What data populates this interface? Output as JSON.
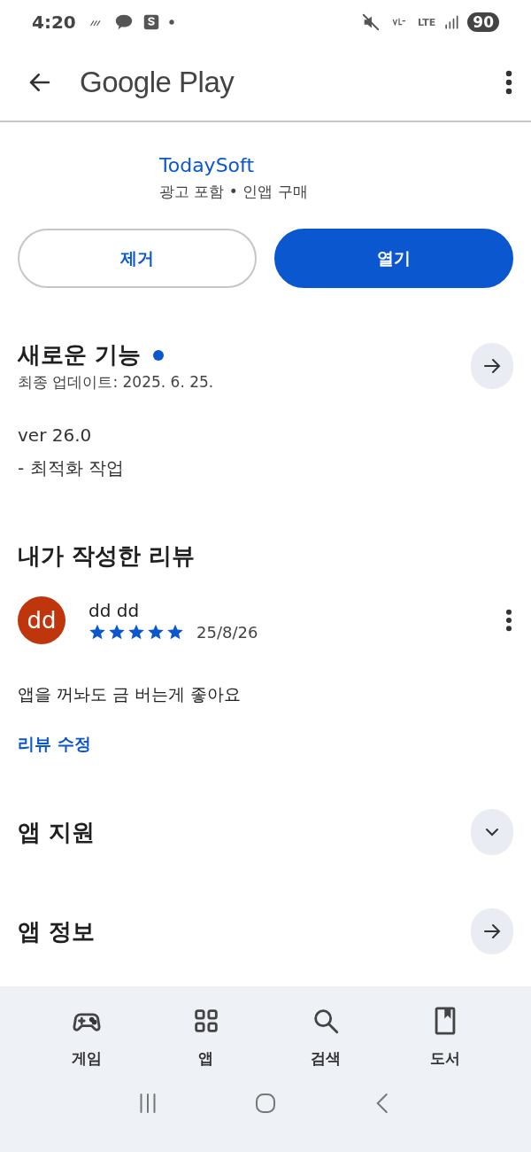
{
  "status_bar": {
    "time": "4:20",
    "battery": "90",
    "network": "LTE"
  },
  "app_bar": {
    "title": "Google Play"
  },
  "app": {
    "developer": "TodaySoft",
    "notes": "광고 포함 • 인앱 구매"
  },
  "buttons": [
    {
      "label": "제거",
      "kind": "outline"
    },
    {
      "label": "열기",
      "kind": "filled"
    }
  ],
  "whats_new": {
    "title": "새로운 기능",
    "new": true,
    "updated": "최종 업데이트: 2025. 6. 25.",
    "lines": [
      "ver 26.0",
      "- 최적화 작업"
    ]
  },
  "my_review": {
    "title": "내가 작성한 리뷰",
    "avatar": "dd",
    "author": "dd dd",
    "stars": 5,
    "date": "25/8/26",
    "text": "앱을 꺼놔도 금 버는게 좋아요",
    "edit_link": "리뷰 수정"
  },
  "sections": [
    {
      "title": "앱 지원",
      "kind": "expand"
    },
    {
      "title": "앱 정보",
      "kind": "arrow"
    }
  ],
  "bottom_nav": [
    {
      "label": "게임",
      "kind": "games",
      "selected": false
    },
    {
      "label": "앱",
      "kind": "apps",
      "selected": false
    },
    {
      "label": "검색",
      "kind": "search",
      "selected": false
    },
    {
      "label": "도서",
      "kind": "books",
      "selected": false
    }
  ]
}
